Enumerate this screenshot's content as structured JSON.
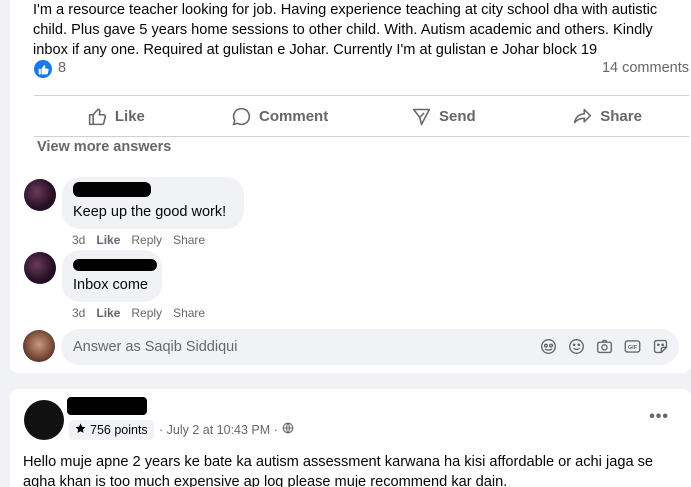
{
  "post": {
    "text": "I'm a resource teacher looking for job. Having experience  teaching at city school dha with autistic child. Plus gave 5 years home sessions to other child. With. Autism academic and others. Kindly inbox if any one. Required at gulistan e Johar. Currently I'm at gulistan e Johar block 19",
    "reaction_count": "8",
    "comment_count": "14 comments"
  },
  "actions": {
    "like": "Like",
    "comment": "Comment",
    "send": "Send",
    "share": "Share"
  },
  "view_more": "View more answers",
  "comments": [
    {
      "text": "Keep up the good work!",
      "time": "3d",
      "like": "Like",
      "reply": "Reply",
      "share": "Share"
    },
    {
      "text": "Inbox come",
      "time": "3d",
      "like": "Like",
      "reply": "Reply",
      "share": "Share"
    }
  ],
  "answer_box": {
    "placeholder": "Answer as Saqib Siddiqui"
  },
  "post2": {
    "points": "756 points",
    "meta": "· July 2 at 10:43 PM ·",
    "text": "Hello muje apne 2 years ke bate ka autism assessment karwana ha kisi affordable or achi jaga se agha khan is too much expensive ap log please muje recommend kar dain."
  },
  "colors": {
    "accent": "#1877f2",
    "muted": "#65676b",
    "bubble": "#f0f2f5"
  }
}
